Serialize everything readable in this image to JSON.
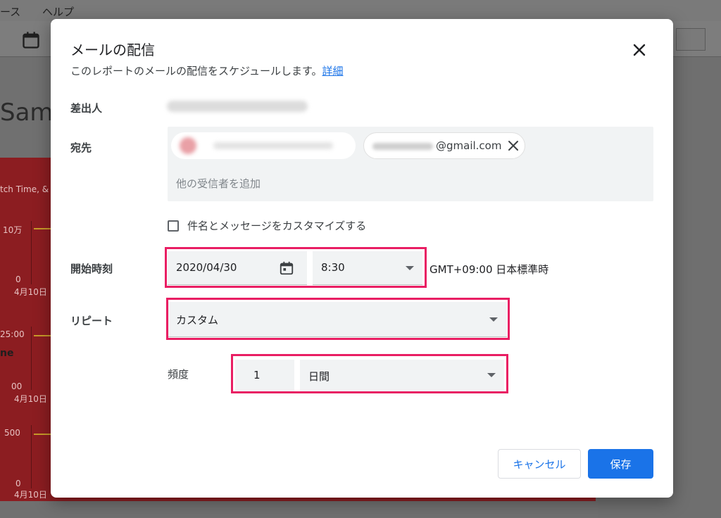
{
  "background": {
    "menu_items": [
      "ース",
      "ヘルプ"
    ],
    "report_title_fragment": "Samp",
    "chart_labels": {
      "title_fragment": "tch Time, &",
      "y1_top": "10万",
      "y1_bottom": "0",
      "x1": "4月10日",
      "y2_top": "25:00",
      "side_text": "ne",
      "y2_bottom": "00",
      "x2": "4月10日",
      "y3_top": "500",
      "y3_bottom": "0",
      "x3": "4月10日"
    }
  },
  "dialog": {
    "title": "メールの配信",
    "subtitle": "このレポートのメールの配信をスケジュールします。",
    "details_link": "詳細",
    "sender_label": "差出人",
    "recipient_label": "宛先",
    "recipient2_domain": "@gmail.com",
    "add_recipient_placeholder": "他の受信者を追加",
    "customize_checkbox_label": "件名とメッセージをカスタマイズする",
    "start_time_label": "開始時刻",
    "start_date": "2020/04/30",
    "start_time": "8:30",
    "timezone": "GMT+09:00 日本標準時",
    "repeat_label": "リピート",
    "repeat_value": "カスタム",
    "frequency_label": "頻度",
    "frequency_count": "1",
    "frequency_unit": "日間",
    "cancel_label": "キャンセル",
    "save_label": "保存"
  },
  "colors": {
    "accent": "#1a73e8",
    "highlight": "#e91e63"
  }
}
